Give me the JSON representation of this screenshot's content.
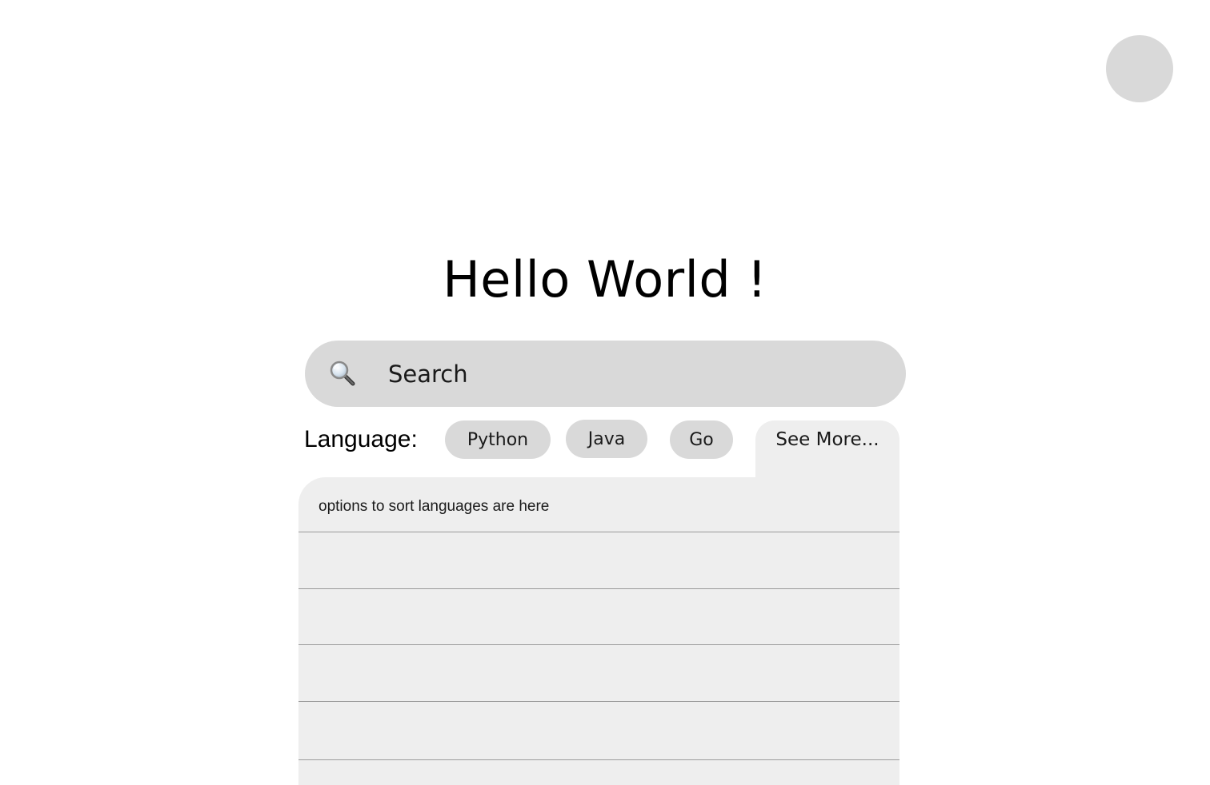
{
  "header": {
    "title": "Hello World !"
  },
  "search": {
    "placeholder": "Search"
  },
  "filters": {
    "label": "Language:",
    "chips": [
      {
        "label": "Python"
      },
      {
        "label": "Java"
      },
      {
        "label": "Go"
      }
    ],
    "see_more_label": "See More..."
  },
  "sort_panel": {
    "header_text": "options to sort languages are here",
    "rows": [
      "",
      "",
      "",
      "",
      ""
    ]
  },
  "colors": {
    "chip_bg": "#d9d9d9",
    "panel_bg": "#eeeeee",
    "divider": "#9a9a9a"
  },
  "icons": {
    "search": "magnifying-glass-icon",
    "avatar": "user-avatar"
  }
}
